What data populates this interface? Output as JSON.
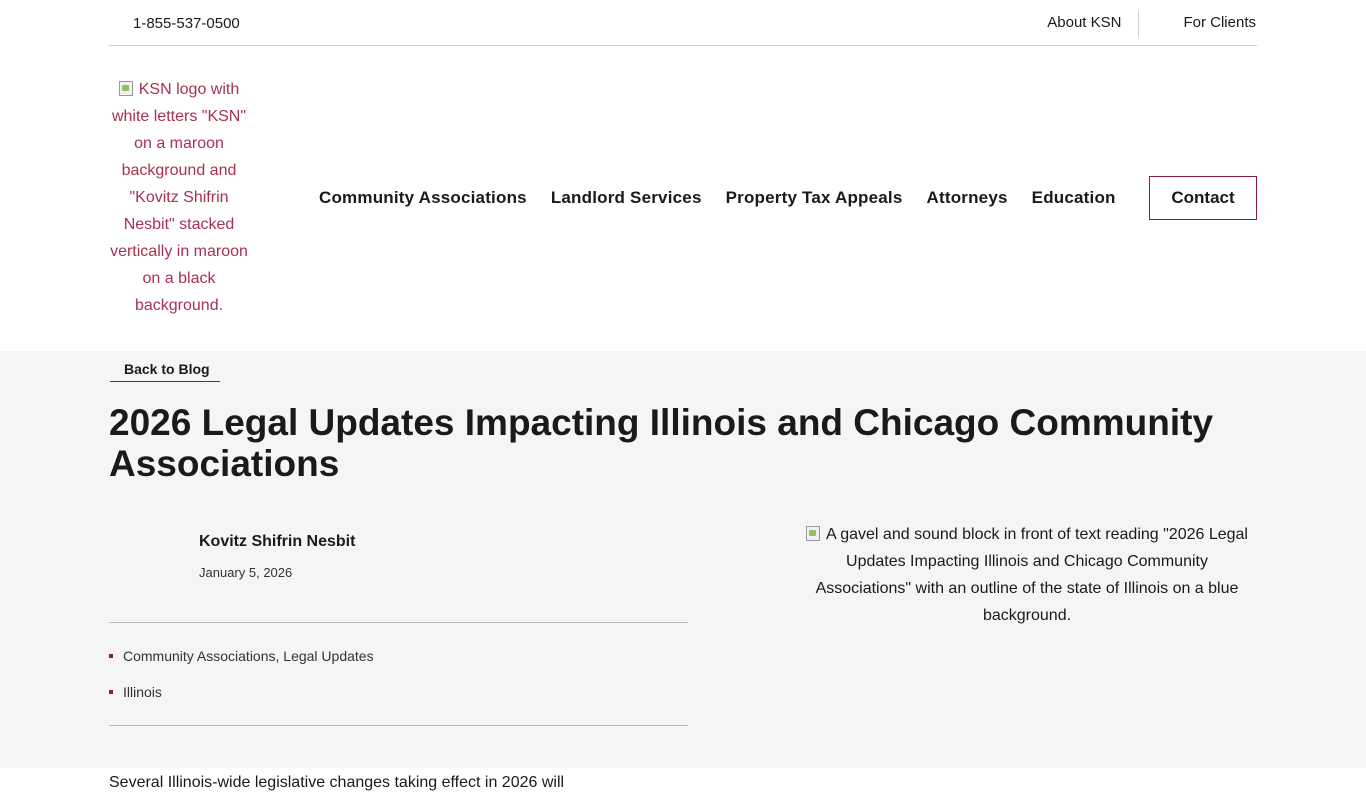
{
  "topbar": {
    "phone": "1-855-537-0500",
    "links": [
      "About KSN",
      "For Clients"
    ]
  },
  "logo": {
    "alt_text": "KSN logo with white letters \"KSN\" on a maroon background and \"Kovitz Shifrin Nesbit\" stacked vertically in maroon on a black background."
  },
  "nav": {
    "items": [
      "Community Associations",
      "Landlord Services",
      "Property Tax Appeals",
      "Attorneys",
      "Education"
    ],
    "contact_label": "Contact"
  },
  "post": {
    "back_label": "Back to Blog",
    "title": "2026 Legal Updates Impacting Illinois and Chicago Community Associations",
    "author": "Kovitz Shifrin Nesbit",
    "date": "January 5, 2026",
    "tags": [
      "Community Associations, Legal Updates",
      "Illinois"
    ],
    "hero_alt": "A gavel and sound block in front of text reading \"2026 Legal Updates Impacting Illinois and Chicago Community Associations\" with an outline of the state of Illinois on a blue background.",
    "body_start": "Several Illinois-wide legislative changes taking effect in 2026 will"
  },
  "colors": {
    "accent": "#8c1d40",
    "link_alt": "#a8324e",
    "content_bg": "#f5f5f5"
  }
}
